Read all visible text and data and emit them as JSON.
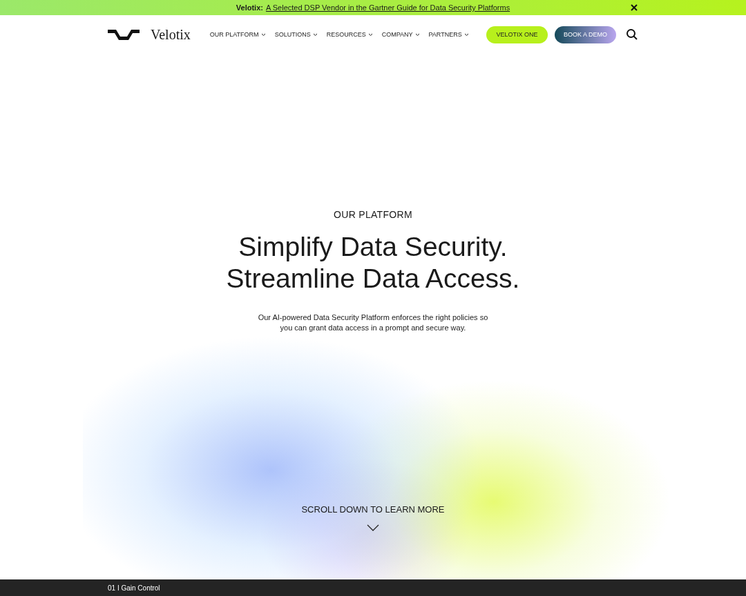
{
  "announcement": {
    "brand": "Velotix:",
    "link": "A Selected DSP Vendor in the Gartner Guide for Data Security Platforms"
  },
  "header": {
    "logo": "Velotix",
    "nav": [
      "OUR PLATFORM",
      "SOLUTIONS",
      "RESOURCES",
      "COMPANY",
      "PARTNERS"
    ],
    "buttons": [
      {
        "label": "VELOTIX ONE",
        "kind": "lime"
      },
      {
        "label": "BOOK A DEMO",
        "kind": "gradient"
      }
    ]
  },
  "hero": {
    "eyebrow": "OUR PLATFORM",
    "title_lines": [
      "Simplify Data Security.",
      "Streamline Data Access."
    ],
    "description": "Our AI-powered Data Security Platform enforces the right policies so you can grant data access in a prompt and secure way.",
    "scroll_hint": "SCROLL DOWN TO LEARN MORE"
  },
  "footer_bar": {
    "label": "01 I Gain Control"
  }
}
